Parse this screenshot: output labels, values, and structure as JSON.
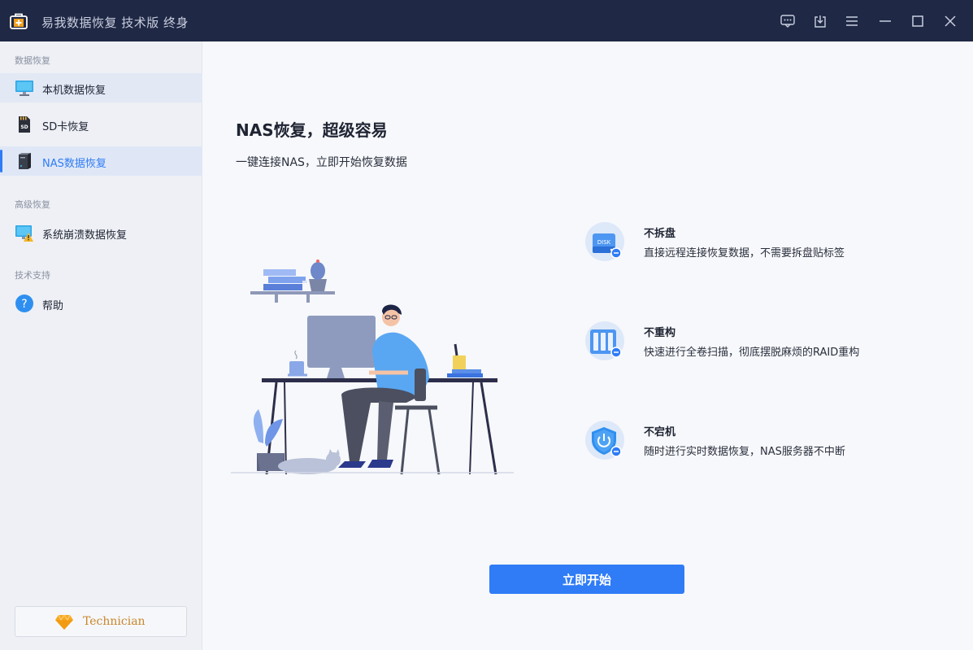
{
  "app": {
    "title": "易我数据恢复 技术版 终身"
  },
  "titlebar": {
    "buttons": [
      "feedback-icon",
      "download-icon",
      "menu-icon",
      "minimize-icon",
      "maximize-icon",
      "close-icon"
    ]
  },
  "sidebar": {
    "sections": [
      {
        "label": "数据恢复",
        "items": [
          {
            "label": "本机数据恢复",
            "icon": "monitor-icon"
          },
          {
            "label": "SD卡恢复",
            "icon": "sd-card-icon"
          },
          {
            "label": "NAS数据恢复",
            "icon": "nas-icon",
            "active": true
          }
        ]
      },
      {
        "label": "高级恢复",
        "items": [
          {
            "label": "系统崩溃数据恢复",
            "icon": "system-crash-icon"
          }
        ]
      },
      {
        "label": "技术支持",
        "items": [
          {
            "label": "帮助",
            "icon": "help-icon"
          }
        ]
      }
    ],
    "technician": {
      "label": "Technician",
      "icon": "diamond-icon"
    }
  },
  "main": {
    "title": "NAS恢复，超级容易",
    "subtitle": "一键连接NAS，立即开始恢复数据",
    "features": [
      {
        "title": "不拆盘",
        "desc": "直接远程连接恢复数据，不需要拆盘贴标签",
        "icon": "disk-icon",
        "icon_text": "DISK"
      },
      {
        "title": "不重构",
        "desc": "快速进行全卷扫描，彻底摆脱麻烦的RAID重构",
        "icon": "raid-icon"
      },
      {
        "title": "不宕机",
        "desc": "随时进行实时数据恢复，NAS服务器不中断",
        "icon": "power-shield-icon"
      }
    ],
    "start_button": "立即开始"
  },
  "colors": {
    "titlebar_bg": "#1f2844",
    "accent": "#2f7cf6",
    "sidebar_bg": "#eef0f5",
    "main_bg": "#f7f8fb",
    "technician_text": "#c8862b"
  }
}
